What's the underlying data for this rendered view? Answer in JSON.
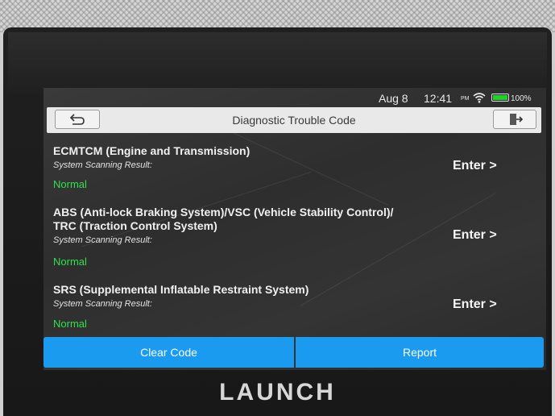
{
  "status_bar": {
    "date": "Aug 8",
    "time": "12:41",
    "ampm": "PM",
    "battery": "100%",
    "icons": [
      "wifi-icon",
      "battery-icon"
    ]
  },
  "header": {
    "title": "Diagnostic Trouble Code",
    "back_icon": "back-arrow-icon",
    "exit_icon": "exit-icon"
  },
  "systems": [
    {
      "name_lines": [
        "ECMTCM (Engine and Transmission)"
      ],
      "label": "System Scanning Result:",
      "status": "Normal",
      "action": "Enter >"
    },
    {
      "name_lines": [
        "ABS (Anti-lock Braking System)/VSC (Vehicle Stability Control)/",
        "TRC (Traction Control System)"
      ],
      "label": "System Scanning Result:",
      "status": "Normal",
      "action": "Enter >"
    },
    {
      "name_lines": [
        "SRS (Supplemental Inflatable Restraint System)"
      ],
      "label": "System Scanning Result:",
      "status": "Normal",
      "action": "Enter >"
    }
  ],
  "actions": {
    "clear_code": "Clear Code",
    "report": "Report"
  },
  "brand": "LAUNCH",
  "colors": {
    "button_blue": "#1a9bf0",
    "status_green": "#2ee24a",
    "battery_green": "#21d12b"
  }
}
